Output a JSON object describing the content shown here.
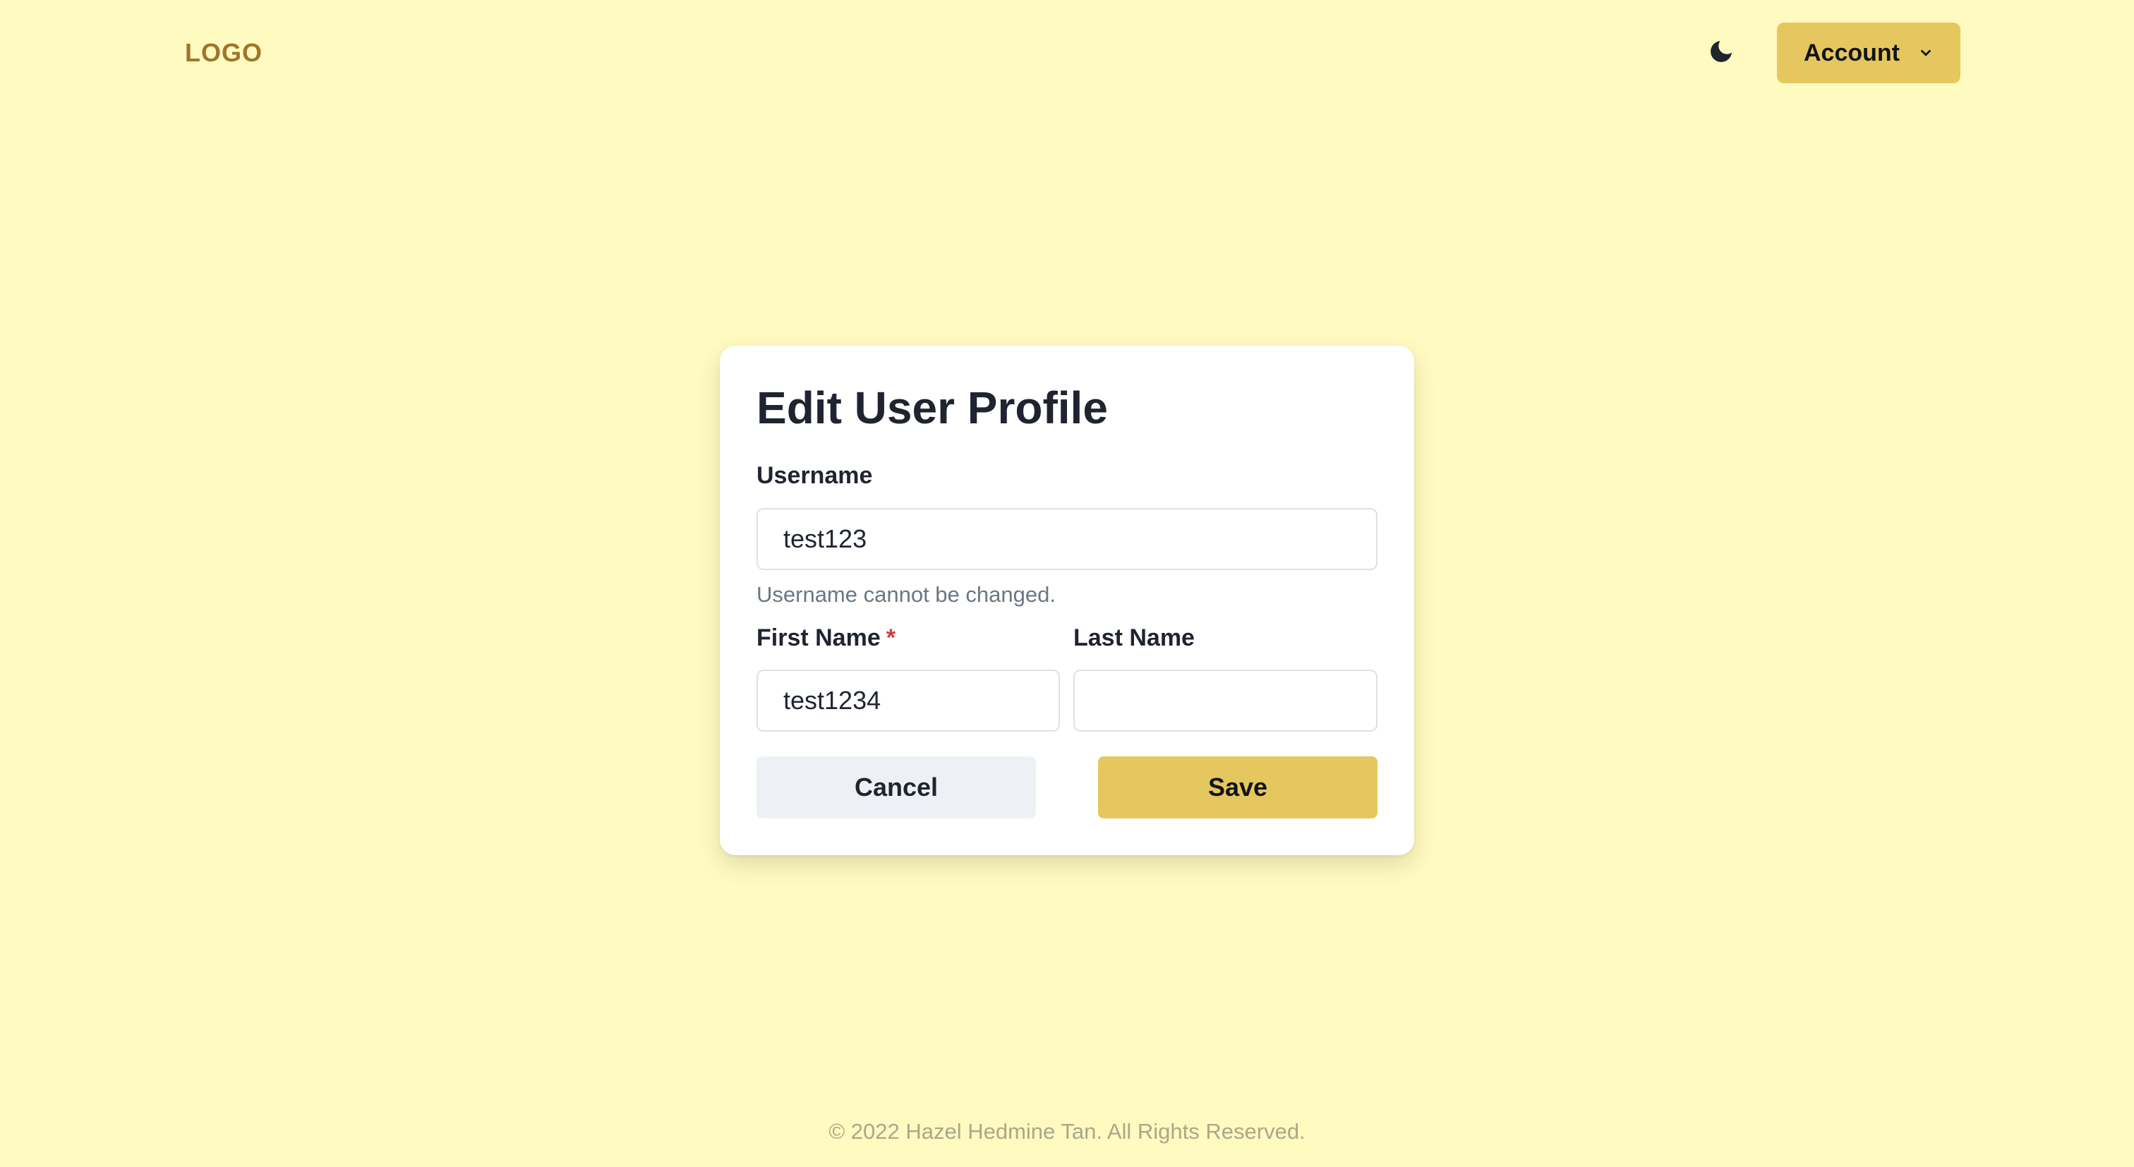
{
  "header": {
    "logo": "LOGO",
    "theme_toggle_icon": "moon-icon",
    "account_label": "Account",
    "account_icon": "chevron-down-icon"
  },
  "form": {
    "title": "Edit User Profile",
    "username": {
      "label": "Username",
      "value": "test123",
      "helper": "Username cannot be changed."
    },
    "first_name": {
      "label": "First Name",
      "required_marker": "*",
      "value": "test1234"
    },
    "last_name": {
      "label": "Last Name",
      "value": ""
    },
    "cancel_label": "Cancel",
    "save_label": "Save"
  },
  "footer": {
    "text": "© 2022 Hazel Hedmine Tan. All Rights Reserved."
  },
  "colors": {
    "background": "#fefac0",
    "accent": "#e6c75f",
    "logo": "#a07527",
    "required": "#d93a3a",
    "cancel_bg": "#edf1f6"
  }
}
